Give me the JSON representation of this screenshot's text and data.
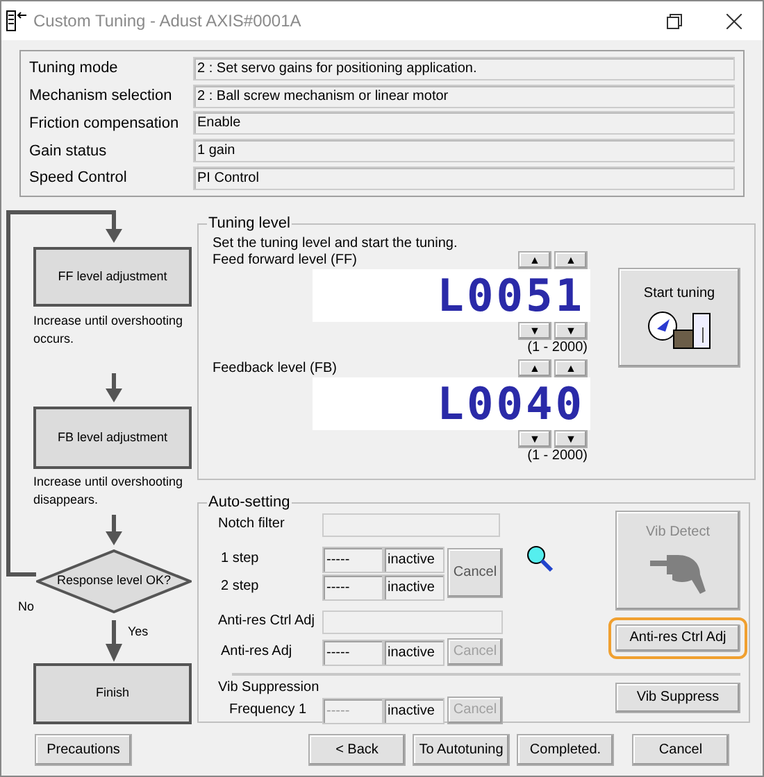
{
  "window": {
    "title": "Custom Tuning - Adust AXIS#0001A"
  },
  "info_rows": [
    {
      "label": "Tuning mode",
      "value": "2 : Set servo gains for positioning application."
    },
    {
      "label": "Mechanism selection",
      "value": "2 : Ball screw mechanism or linear motor"
    },
    {
      "label": "Friction compensation",
      "value": "Enable"
    },
    {
      "label": "Gain status",
      "value": "1 gain"
    },
    {
      "label": "Speed Control",
      "value": "PI Control"
    }
  ],
  "flowchart": {
    "ff_step": "FF level adjustment",
    "ff_note": "Increase until overshooting occurs.",
    "fb_step": "FB level adjustment",
    "fb_note": "Increase until overshooting disappears.",
    "decision": "Response level OK?",
    "no_label": "No",
    "yes_label": "Yes",
    "finish": "Finish"
  },
  "tuning_level": {
    "title": "Tuning level",
    "instruction": "Set the tuning level and start the tuning.",
    "up": "▲",
    "down": "▼",
    "levels": [
      {
        "label": "Feed forward level (FF)",
        "display": "L0051",
        "range": "(1 - 2000)"
      },
      {
        "label": "Feedback level (FB)",
        "display": "L0040",
        "range": "(1 - 2000)"
      }
    ],
    "start_button": "Start tuning"
  },
  "auto_setting": {
    "title": "Auto-setting",
    "notch_filter": "Notch filter",
    "steps": [
      {
        "label": "1 step",
        "value": "-----",
        "status": "inactive"
      },
      {
        "label": "2 step",
        "value": "-----",
        "status": "inactive"
      }
    ],
    "steps_cancel": {
      "label": "Cancel",
      "disabled": false
    },
    "vib_detect": {
      "label": "Vib Detect",
      "disabled": true
    },
    "anti_res_ctrl_label": "Anti-res Ctrl Adj",
    "anti_res_adj": {
      "label": "Anti-res Adj",
      "value": "-----",
      "status": "inactive",
      "cancel": "Cancel",
      "cancel_disabled": true
    },
    "anti_res_button": {
      "label": "Anti-res Ctrl Adj",
      "highlighted": true
    },
    "vib_suppression": "Vib Suppression",
    "frequency": {
      "label": "Frequency 1",
      "value": "-----",
      "status": "inactive",
      "cancel": "Cancel",
      "cancel_disabled": true,
      "value_disabled": true
    },
    "vib_suppress_button": "Vib Suppress"
  },
  "buttons": [
    {
      "label": "Precautions"
    },
    {
      "label": "< Back"
    },
    {
      "label": "To Autotuning"
    },
    {
      "label": "Completed."
    },
    {
      "label": "Cancel"
    }
  ]
}
